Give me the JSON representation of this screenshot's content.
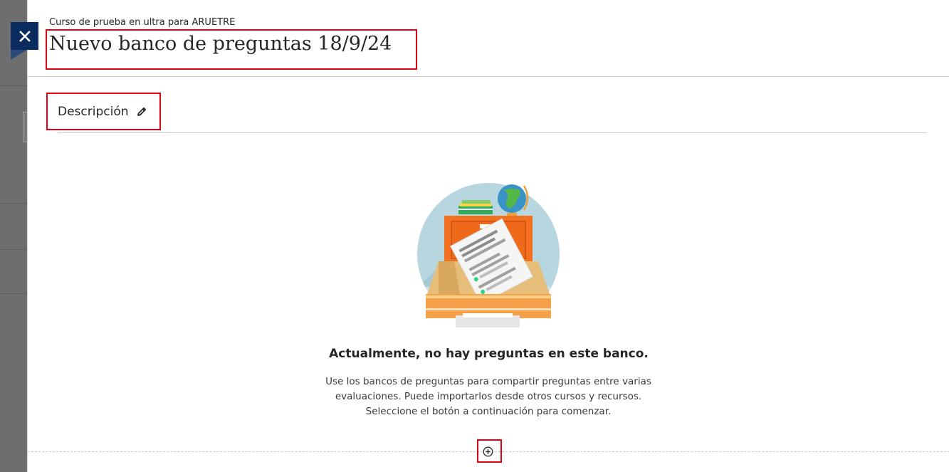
{
  "header": {
    "course_name": "Curso de prueba en ultra para ARUETRE",
    "title": "Nuevo banco de preguntas 18/9/24",
    "close_icon": "close-icon"
  },
  "description": {
    "label": "Descripción",
    "edit_icon": "pencil-icon"
  },
  "empty_state": {
    "illustration": "file-cabinet-illustration",
    "title": "Actualmente, no hay preguntas en este banco.",
    "body_lines": [
      "Use los bancos de preguntas para compartir preguntas entre varias",
      "evaluaciones. Puede importarlos desde otros cursos y recursos.",
      "Seleccione el botón a continuación para comenzar."
    ]
  },
  "add_button": {
    "icon": "plus-circle-icon"
  },
  "colors": {
    "close_button": "#0a2c5e",
    "highlight": "#e3000f",
    "cabinet": "#f37021",
    "circle": "#b7d6e0"
  }
}
